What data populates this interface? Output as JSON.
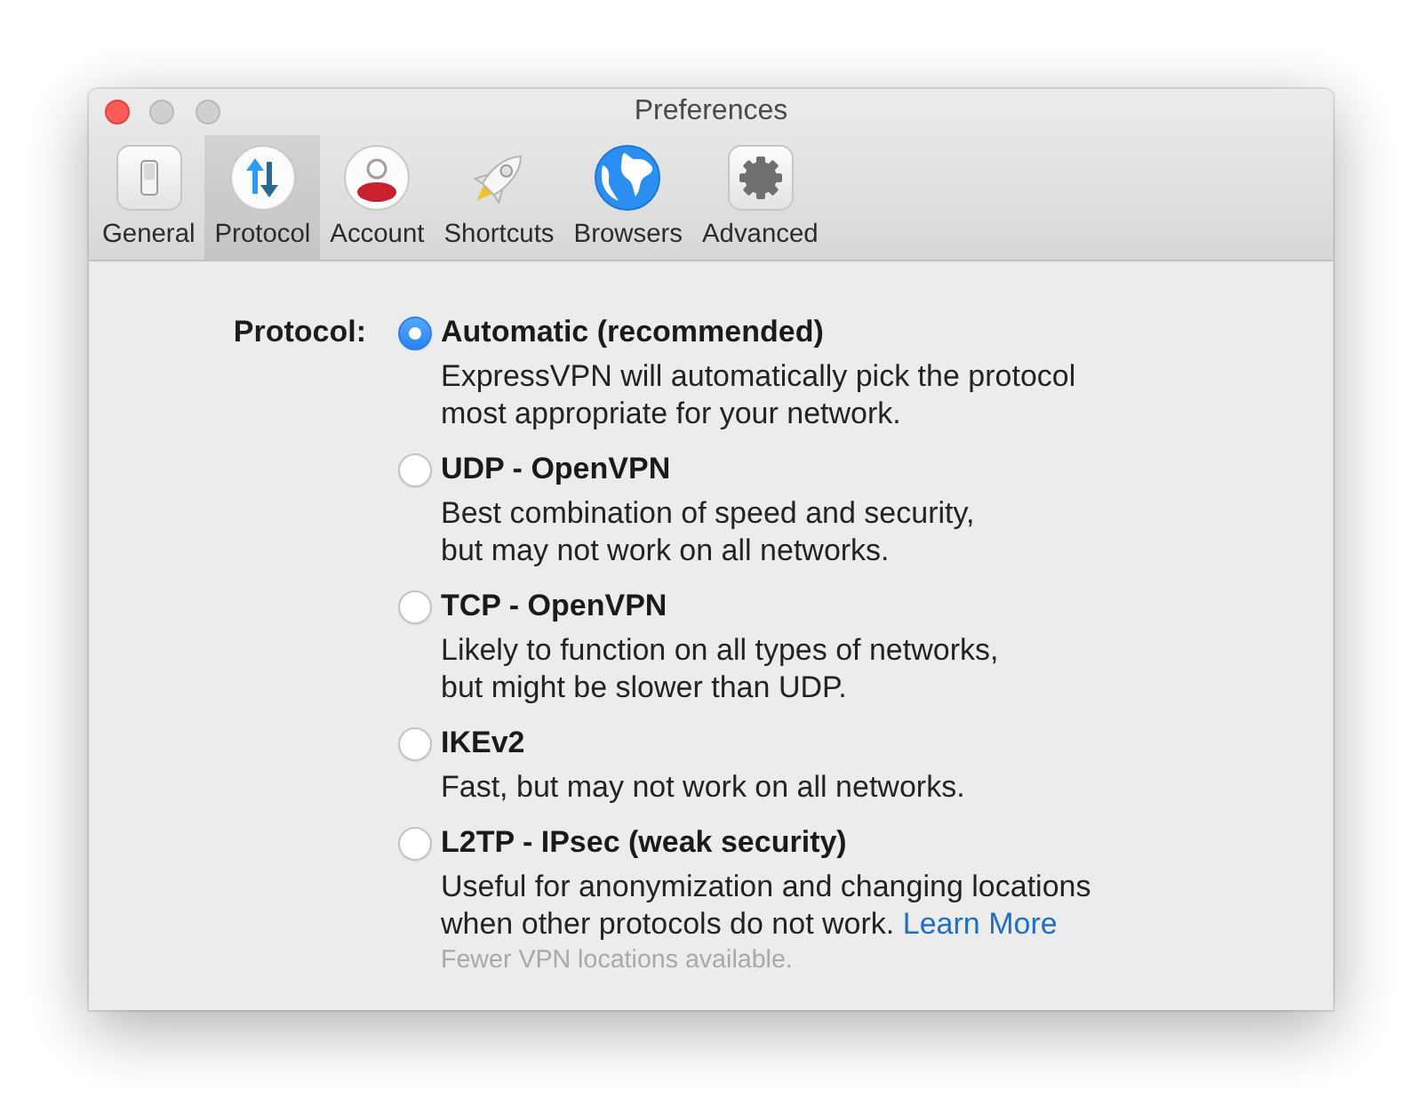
{
  "window": {
    "title": "Preferences",
    "controls": [
      {
        "kind": "close",
        "disabled": false
      },
      {
        "kind": "minimize",
        "disabled": true
      },
      {
        "kind": "zoom",
        "disabled": true
      }
    ]
  },
  "toolbar": {
    "items": [
      {
        "label": "General",
        "selected": false
      },
      {
        "label": "Protocol",
        "selected": true
      },
      {
        "label": "Account",
        "selected": false
      },
      {
        "label": "Shortcuts",
        "selected": false
      },
      {
        "label": "Browsers",
        "selected": false
      },
      {
        "label": "Advanced",
        "selected": false
      }
    ]
  },
  "protocol": {
    "label": "Protocol:",
    "options": [
      {
        "title": "Automatic (recommended)",
        "description": [
          "ExpressVPN will automatically pick the protocol",
          "most appropriate for your network."
        ],
        "selected": true
      },
      {
        "title": "UDP - OpenVPN",
        "description": [
          "Best combination of speed and security,",
          "but may not work on all networks."
        ],
        "selected": false
      },
      {
        "title": "TCP - OpenVPN",
        "description": [
          "Likely to function on all types of networks,",
          "but might be slower than UDP."
        ],
        "selected": false
      },
      {
        "title": "IKEv2",
        "description": [
          "Fast, but may not work on all networks."
        ],
        "selected": false
      },
      {
        "title": "L2TP - IPsec (weak security)",
        "description": [
          "Useful for anonymization and changing locations",
          "when other protocols do not work."
        ],
        "link": "Learn More",
        "note": "Fewer VPN locations available.",
        "selected": false
      }
    ]
  }
}
